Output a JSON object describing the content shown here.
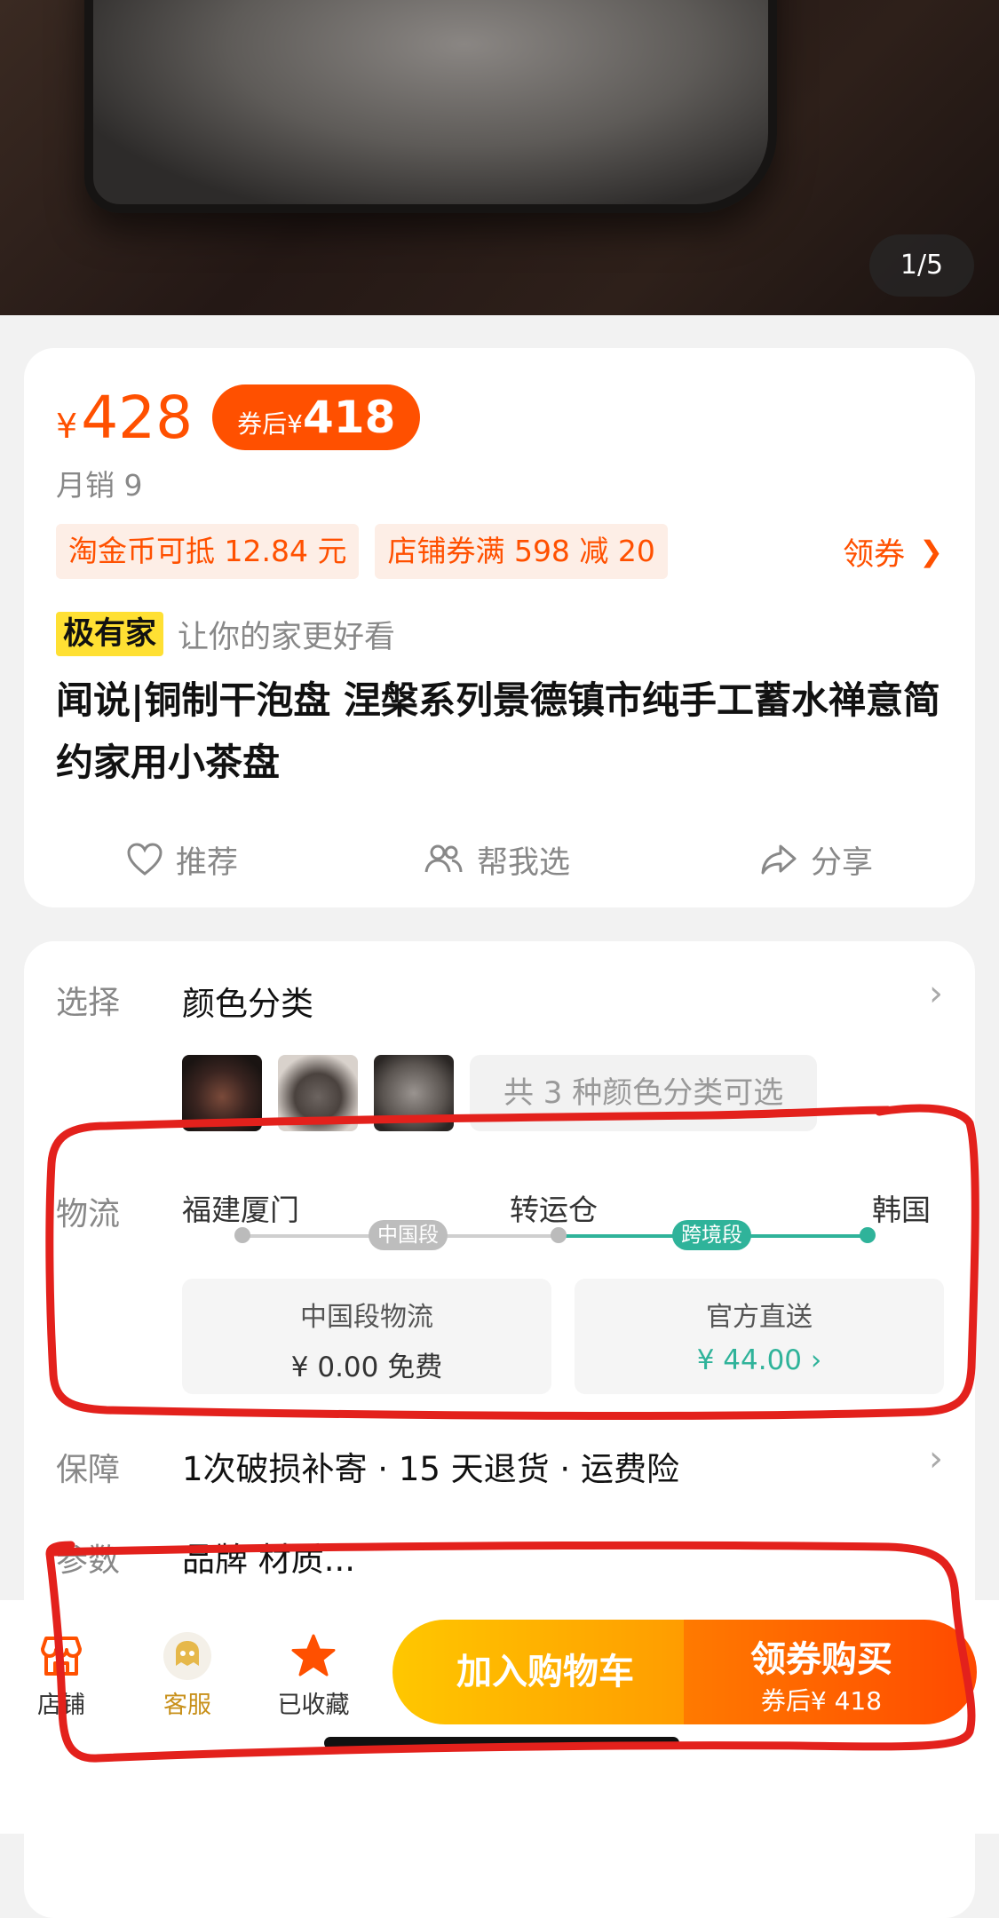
{
  "hero": {
    "image_counter": "1/5"
  },
  "pricing": {
    "currency": "¥",
    "price": "428",
    "coupon_label": "券后¥",
    "coupon_price": "418",
    "monthly_sales": "月销 9"
  },
  "promos": {
    "tags": [
      "淘金币可抵 12.84 元",
      "店铺券满 598 减 20"
    ],
    "get_coupon": "领券"
  },
  "brand": {
    "badge": "极有家",
    "slogan": "让你的家更好看"
  },
  "product_title": "闻说|铜制干泡盘 涅槃系列景德镇市纯手工蓄水禅意简约家用小茶盘",
  "actions": {
    "recommend": "推荐",
    "help_choose": "帮我选",
    "share": "分享"
  },
  "select": {
    "label": "选择",
    "value": "颜色分类",
    "summary": "共 3 种颜色分类可选"
  },
  "logistics": {
    "label": "物流",
    "from": "福建厦门",
    "via": "转运仓",
    "to": "韩国",
    "seg1": "中国段",
    "seg2": "跨境段",
    "box1_title": "中国段物流",
    "box1_value": "¥ 0.00 免费",
    "box2_title": "官方直送",
    "box2_value": "¥ 44.00",
    "box2_color": "#2fb39a"
  },
  "guarantee": {
    "label": "保障",
    "value": "1次破损补寄 · 15 天退货 · 运费险"
  },
  "params": {
    "label": "参数",
    "value": "品牌 材质..."
  },
  "bottom_bar": {
    "store": "店铺",
    "service": "客服",
    "favorited": "已收藏",
    "add_to_cart": "加入购物车",
    "buy": "领券购买",
    "buy_sub": "券后¥ 418"
  },
  "colors": {
    "accent": "#ff5000",
    "annotation": "#e3211c",
    "teal": "#2fb39a"
  }
}
